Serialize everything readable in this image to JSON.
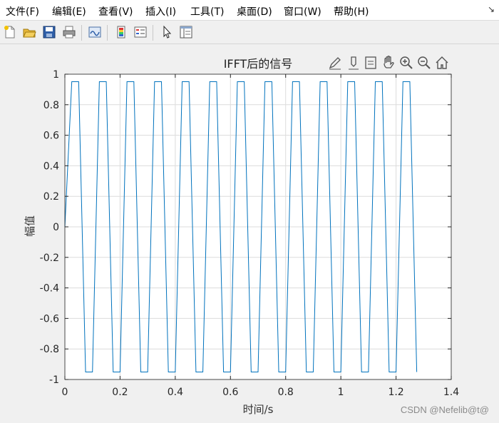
{
  "menu": {
    "items": [
      {
        "label": "文件(F)"
      },
      {
        "label": "编辑(E)"
      },
      {
        "label": "查看(V)"
      },
      {
        "label": "插入(I)"
      },
      {
        "label": "工具(T)"
      },
      {
        "label": "桌面(D)"
      },
      {
        "label": "窗口(W)"
      },
      {
        "label": "帮助(H)"
      }
    ],
    "corner_glyph": "↘"
  },
  "toolbar": {
    "buttons": [
      {
        "icon": "new-figure-icon"
      },
      {
        "icon": "open-file-icon"
      },
      {
        "icon": "save-icon"
      },
      {
        "icon": "print-icon"
      },
      {
        "icon": "link-plot-icon"
      },
      {
        "icon": "insert-colorbar-icon"
      },
      {
        "icon": "insert-legend-icon"
      },
      {
        "icon": "edit-plot-pointer-icon"
      },
      {
        "icon": "property-inspector-icon"
      }
    ]
  },
  "axes_toolbar": {
    "buttons": [
      "brush-icon",
      "data-tips-icon",
      "export-icon",
      "pan-icon",
      "zoom-in-icon",
      "zoom-out-icon",
      "home-icon"
    ]
  },
  "chart_data": {
    "type": "line",
    "title": "IFFT后的信号",
    "xlabel": "时间/s",
    "ylabel": "幅值",
    "xlim": [
      0,
      1.4
    ],
    "ylim": [
      -1,
      1
    ],
    "xticks": [
      0,
      0.2,
      0.4,
      0.6,
      0.8,
      1,
      1.2,
      1.4
    ],
    "xtick_labels": [
      "0",
      "0.2",
      "0.4",
      "0.6",
      "0.8",
      "1",
      "1.2",
      "1.4"
    ],
    "yticks": [
      1,
      0.8,
      0.6,
      0.4,
      0.2,
      0,
      -0.2,
      -0.4,
      -0.6,
      -0.8,
      -1
    ],
    "ytick_labels": [
      "1",
      "0.8",
      "0.6",
      "0.4",
      "0.2",
      "0",
      "-0.2",
      "-0.4",
      "-0.6",
      "-0.8",
      "-1"
    ],
    "grid": true,
    "series": [
      {
        "color": "#0072BD",
        "x": [
          0,
          0.025,
          0.05,
          0.075,
          0.1,
          0.125,
          0.15,
          0.175,
          0.2,
          0.225,
          0.25,
          0.275,
          0.3,
          0.325,
          0.35,
          0.375,
          0.4,
          0.425,
          0.45,
          0.475,
          0.5,
          0.525,
          0.55,
          0.575,
          0.6,
          0.625,
          0.65,
          0.675,
          0.7,
          0.725,
          0.75,
          0.775,
          0.8,
          0.825,
          0.85,
          0.875,
          0.9,
          0.925,
          0.95,
          0.975,
          1.0,
          1.025,
          1.05,
          1.075,
          1.1,
          1.125,
          1.15,
          1.175,
          1.2,
          1.225,
          1.25,
          1.275
        ],
        "y": [
          0,
          0.951,
          0.951,
          -0.951,
          -0.951,
          0.951,
          0.951,
          -0.951,
          -0.951,
          0.951,
          0.951,
          -0.951,
          -0.951,
          0.951,
          0.951,
          -0.951,
          -0.951,
          0.951,
          0.951,
          -0.951,
          -0.951,
          0.951,
          0.951,
          -0.951,
          -0.951,
          0.951,
          0.951,
          -0.951,
          -0.951,
          0.951,
          0.951,
          -0.951,
          -0.951,
          0.951,
          0.951,
          -0.951,
          -0.951,
          0.951,
          0.951,
          -0.951,
          -0.951,
          0.951,
          0.951,
          -0.951,
          -0.951,
          0.951,
          0.951,
          -0.951,
          -0.951,
          0.951,
          0.951,
          -0.951
        ]
      }
    ]
  },
  "watermark": "CSDN @Nefelib@t@"
}
